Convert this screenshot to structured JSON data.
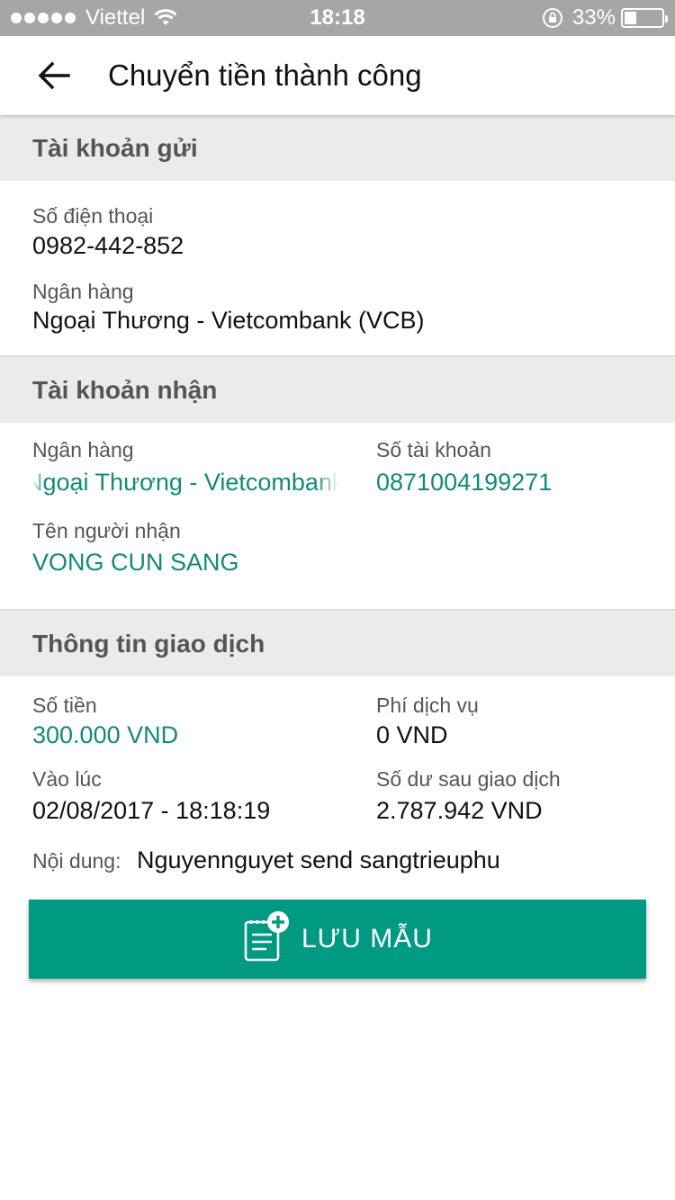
{
  "status_bar": {
    "carrier": "Viettel",
    "time": "18:18",
    "battery_percent": "33%",
    "battery_level": 0.33,
    "icons": [
      "signal-dots-icon",
      "wifi-icon",
      "rotation-lock-icon",
      "battery-icon"
    ]
  },
  "header": {
    "back_icon": "arrow-left-icon",
    "title": "Chuyển tiền thành công"
  },
  "sender": {
    "section_title": "Tài khoản gửi",
    "phone_label": "Số điện thoại",
    "phone_value": "0982-442-852",
    "bank_label": "Ngân hàng",
    "bank_value": "Ngoại Thương - Vietcombank (VCB)"
  },
  "receiver": {
    "section_title": "Tài khoản nhận",
    "bank_label": "Ngân hàng",
    "bank_value": "Ngoại Thương - Vietcombank (VCB)",
    "account_label": "Số tài khoản",
    "account_value": "0871004199271",
    "name_label": "Tên người nhận",
    "name_value": "VONG CUN SANG"
  },
  "transaction": {
    "section_title": "Thông tin giao dịch",
    "amount_label": "Số tiền",
    "amount_value": "300.000 VND",
    "fee_label": "Phí dịch vụ",
    "fee_value": "0 VND",
    "time_label": "Vào lúc",
    "time_value": "02/08/2017 - 18:18:19",
    "balance_label": "Số dư sau giao dịch",
    "balance_value": "2.787.942 VND",
    "content_label": "Nội dung:",
    "content_value": "Nguyennguyet send sangtrieuphu"
  },
  "save_button": {
    "icon": "note-add-icon",
    "label": "LƯU MẪU"
  },
  "colors": {
    "accent_green": "#009982",
    "value_green": "#138a78",
    "section_bg": "#ebebeb",
    "status_bar_bg": "#a6a6a6"
  }
}
